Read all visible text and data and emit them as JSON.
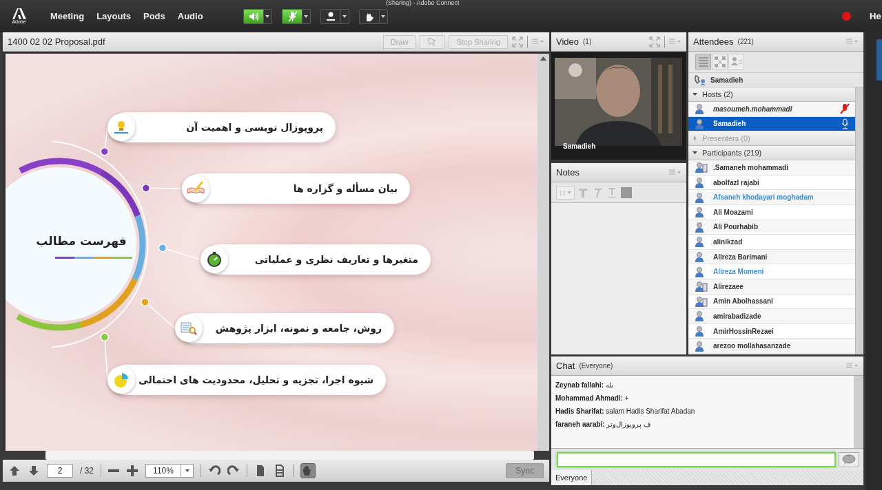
{
  "window_title": "(Sharing) - Adobe Connect",
  "app_bar": {
    "logo": "Adobe",
    "menus": [
      {
        "label": "Meeting"
      },
      {
        "label": "Layouts"
      },
      {
        "label": "Pods"
      },
      {
        "label": "Audio"
      }
    ],
    "controls": [
      {
        "kind": "speaker",
        "on": true
      },
      {
        "kind": "mic",
        "on": true
      },
      {
        "kind": "camera",
        "on": false
      },
      {
        "kind": "hand",
        "on": false
      }
    ],
    "recording": true,
    "help": "He"
  },
  "share_pod": {
    "title": "1400 02 02 Proposal.pdf",
    "header_buttons": [
      {
        "kind": "text",
        "label": "Draw"
      },
      {
        "kind": "pointer"
      },
      {
        "kind": "text",
        "label": "Stop Sharing"
      }
    ],
    "slide": {
      "title": "فهرست مطالب",
      "items": [
        {
          "text": "پروپوزال نویسی و اهمیت آن",
          "color": "#8a3fc8"
        },
        {
          "text": "بیان مسأله و گزاره ها",
          "color": "#7a38b8"
        },
        {
          "text": "متغیرها و تعاریف نظری و عملیاتی",
          "color": "#6aaee0"
        },
        {
          "text": "روش، جامعه و نمونه، ابزار پژوهش",
          "color": "#e0a020"
        },
        {
          "text": "شیوه اجرا، تجزیه و تحلیل، محدودیت های احتمالی",
          "color": "#8cc63f"
        }
      ]
    },
    "pager": {
      "page": "2",
      "total": "/ 32",
      "zoom": "110%",
      "hand_tool_selected": true,
      "sync": "Sync"
    }
  },
  "video_pod": {
    "title": "Video",
    "count": "(1)",
    "feed_name": "Samadieh"
  },
  "notes_pod": {
    "title": "Notes",
    "font_size": "11"
  },
  "attendees_pod": {
    "title": "Attendees",
    "count": "(221)",
    "view_modes": [
      {
        "selected": true
      },
      {
        "selected": false
      },
      {
        "selected": false
      }
    ],
    "current_user": "Samadieh",
    "groups": [
      {
        "label": "Hosts (2)",
        "expanded": true,
        "members": [
          {
            "name": "masoumeh.mohammadi",
            "kind": "desktop",
            "italic": true,
            "selected": false,
            "muted": true,
            "color": "#333333"
          },
          {
            "name": "Samadieh",
            "kind": "desktop",
            "italic": false,
            "selected": true,
            "muted": false,
            "color": "#ffffff"
          }
        ]
      },
      {
        "label": "Presenters (0)",
        "expanded": false
      },
      {
        "label": "Participants (219)",
        "expanded": true,
        "members": [
          {
            "name": ".Samaneh mohammadi",
            "kind": "mobile",
            "color": "#333333"
          },
          {
            "name": "abolfazl rajabi",
            "kind": "desktop",
            "color": "#333333"
          },
          {
            "name": "Afsaneh khodayari moghadam",
            "kind": "desktop",
            "color": "#3a8fd6"
          },
          {
            "name": "Ali Moazami",
            "kind": "desktop",
            "color": "#333333"
          },
          {
            "name": "Ali Pourhabib",
            "kind": "desktop",
            "color": "#333333"
          },
          {
            "name": "alinikzad",
            "kind": "desktop",
            "color": "#333333"
          },
          {
            "name": "Alireza Barimani",
            "kind": "desktop",
            "color": "#333333"
          },
          {
            "name": "Alireza Momeni",
            "kind": "desktop",
            "color": "#3a8fd6"
          },
          {
            "name": "Alirezaee",
            "kind": "mobile",
            "color": "#333333"
          },
          {
            "name": "Amin Abolhassani",
            "kind": "mobile",
            "color": "#333333"
          },
          {
            "name": "amirabadizade",
            "kind": "desktop",
            "color": "#333333"
          },
          {
            "name": "AmirHossinRezaei",
            "kind": "desktop",
            "color": "#333333"
          },
          {
            "name": "arezoo mollahasanzade",
            "kind": "desktop",
            "color": "#333333"
          }
        ]
      }
    ]
  },
  "chat_pod": {
    "title": "Chat",
    "scope": "(Everyone)",
    "messages": [
      {
        "text": "**Zeynab fallahi:** بله"
      },
      {
        "text": "**Mohammad Ahmadi:** +"
      },
      {
        "text": "**Hadis Sharifat:** salam Hadis Sharifat Abadan"
      },
      {
        "text": "**faraneh aarabi:** ف پروپوزال‌وتر"
      }
    ],
    "tab": "Everyone"
  }
}
